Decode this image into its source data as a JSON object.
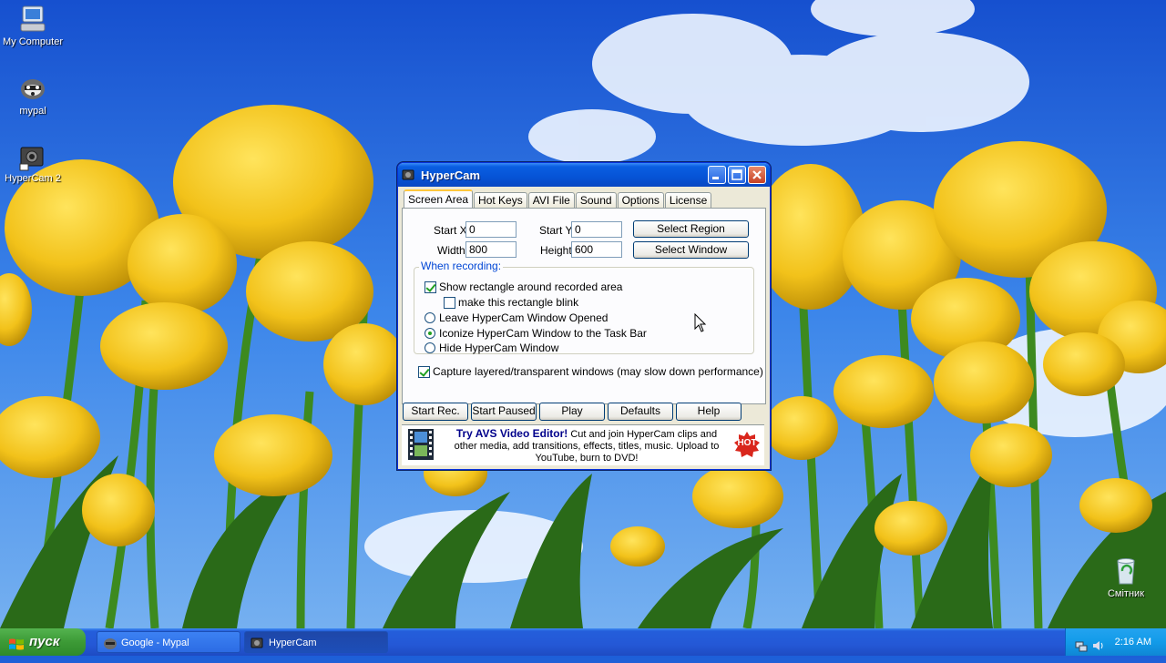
{
  "desktop": {
    "icons": [
      {
        "label": "My Computer",
        "icon": "my-computer-icon"
      },
      {
        "label": "mypal",
        "icon": "mypal-icon"
      },
      {
        "label": "HyperCam 2",
        "icon": "hypercam-icon"
      },
      {
        "label": "Смітник",
        "icon": "recycle-bin-icon"
      }
    ]
  },
  "window": {
    "title": "HyperCam",
    "tabs": [
      "Screen Area",
      "Hot Keys",
      "AVI File",
      "Sound",
      "Options",
      "License"
    ],
    "active_tab": "Screen Area",
    "screen_area": {
      "start_x_label": "Start X",
      "start_x": "0",
      "start_y_label": "Start Y",
      "start_y": "0",
      "width_label": "Width",
      "width": "800",
      "height_label": "Height",
      "height": "600",
      "select_region": "Select Region",
      "select_window": "Select Window",
      "when_recording": "When recording:",
      "show_rect": "Show rectangle around recorded area",
      "show_rect_checked": true,
      "blink": "make this rectangle blink",
      "blink_checked": false,
      "opt_leave": "Leave HyperCam Window Opened",
      "opt_iconize": "Iconize HyperCam Window to the Task Bar",
      "opt_hide": "Hide HyperCam Window",
      "selected_option": "opt_iconize",
      "capture_layered": "Capture layered/transparent windows (may slow down performance)",
      "capture_layered_checked": true
    },
    "buttons": {
      "start_rec": "Start Rec.",
      "start_paused": "Start Paused",
      "play": "Play",
      "defaults": "Defaults",
      "help": "Help"
    },
    "ad": {
      "headline": "Try AVS Video Editor!",
      "body_1": " Cut and join HyperCam clips and",
      "body_2": "other media, add transitions, effects, titles, music. Upload to",
      "body_3": "YouTube, burn to DVD!",
      "hot": "HOT"
    }
  },
  "taskbar": {
    "start_label": "пуск",
    "tasks": [
      {
        "label": "Google - Mypal",
        "active": false
      },
      {
        "label": "HyperCam",
        "active": true
      }
    ],
    "clock": "2:16 AM"
  },
  "colors": {
    "title_blue": "#0653d6",
    "start_green": "#3c9a36",
    "tab_highlight": "#ffc73c",
    "group_title": "#0046d5",
    "hot_red": "#d9261c"
  }
}
